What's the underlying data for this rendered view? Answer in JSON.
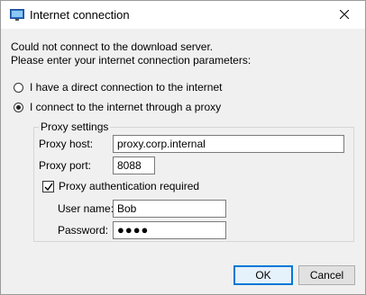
{
  "window": {
    "title": "Internet connection",
    "app_icon": "monitor-icon",
    "close_icon": "close-icon"
  },
  "message": {
    "line1": "Could not connect to the download server.",
    "line2": "Please enter your internet connection parameters:"
  },
  "options": [
    {
      "label": "I have a direct connection to the internet",
      "checked": false
    },
    {
      "label": "I connect to the internet through a proxy",
      "checked": true
    }
  ],
  "proxy": {
    "group_title": "Proxy settings",
    "host_label": "Proxy host:",
    "host_value": "proxy.corp.internal",
    "port_label": "Proxy port:",
    "port_value": "8088",
    "auth_label": "Proxy authentication required",
    "auth_checked": true,
    "username_label": "User name:",
    "username_value": "Bob",
    "password_label": "Password:",
    "password_value": "●●●●"
  },
  "buttons": {
    "ok": "OK",
    "cancel": "Cancel"
  },
  "colors": {
    "accent": "#0078d7",
    "dialog_bg": "#f0f0f0"
  }
}
